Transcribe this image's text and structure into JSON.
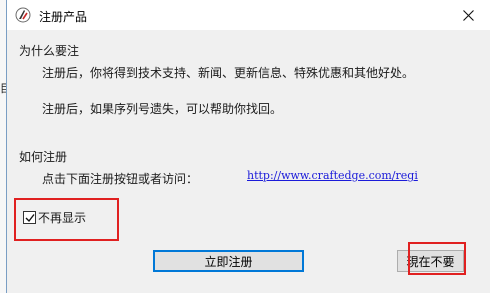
{
  "background": {
    "partial_glyph": "目"
  },
  "window": {
    "title": "注册产品",
    "close_icon": "close-icon",
    "app_icon": "craftedge-logo-icon"
  },
  "section_why": {
    "heading": "为什么要注",
    "line1": "注册后，你将得到技术支持、新闻、更新信息、特殊优惠和其他好处。",
    "line2": "注册后，如果序列号遗失，可以帮助你找回。"
  },
  "section_how": {
    "heading": "如何注册",
    "instruction": "点击下面注册按钮或者访问：",
    "link_text": "http://www.craftedge.com/regi"
  },
  "dont_show": {
    "label": "不再显示",
    "checked": true
  },
  "buttons": {
    "register": "立即注册",
    "later": "現在不要"
  },
  "colors": {
    "highlight_box": "#e02020",
    "link": "#1b1bd9",
    "focus_border": "#0078d7"
  }
}
